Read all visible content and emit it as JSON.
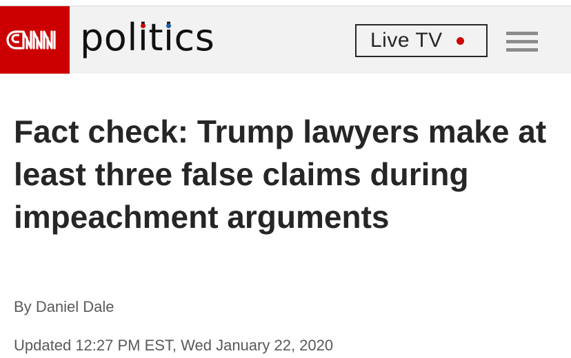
{
  "header": {
    "logo_text": "CNN",
    "section_text": "politics",
    "section_parts": {
      "before_first_i": "pol",
      "first_i": "i",
      "middle": "t",
      "second_i": "i",
      "after": "cs"
    },
    "section_dot_colors": [
      "#cc0000",
      "#1e5aa8"
    ],
    "live_tv_label": "Live TV",
    "menu_icon": "hamburger-menu-icon"
  },
  "article": {
    "headline": "Fact check: Trump lawyers make at least three false claims during impeachment arguments",
    "byline_prefix": "By",
    "author": "Daniel Dale",
    "timestamp": "Updated 12:27 PM EST, Wed January 22, 2020"
  },
  "colors": {
    "brand_red": "#cc0000",
    "header_bg": "#f2f2f2",
    "live_dot": "#cc0000",
    "headline": "#262626",
    "meta_text": "#595959"
  }
}
